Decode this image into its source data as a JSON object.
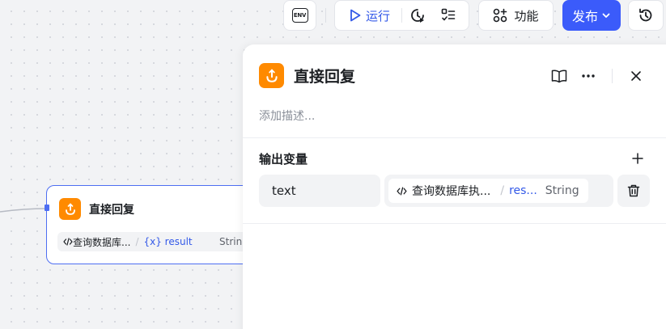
{
  "toolbar": {
    "env_label": "ENV",
    "run_label": "运行",
    "function_label": "功能",
    "publish_label": "发布",
    "colors": {
      "primary": "#3b5bfa",
      "link": "#3359e8"
    }
  },
  "node": {
    "title": "直接回复",
    "ref_source": "查询数据库...",
    "ref_variable": "{x} result",
    "ref_type": "Strin",
    "icon": "reply-app-icon",
    "icon_color": "#ff8a00"
  },
  "panel": {
    "title": "直接回复",
    "description_placeholder": "添加描述...",
    "output_section_title": "输出变量",
    "outputs": [
      {
        "name": "text",
        "ref_source": "查询数据库执...",
        "ref_variable": "res...",
        "ref_type": "String"
      }
    ]
  }
}
